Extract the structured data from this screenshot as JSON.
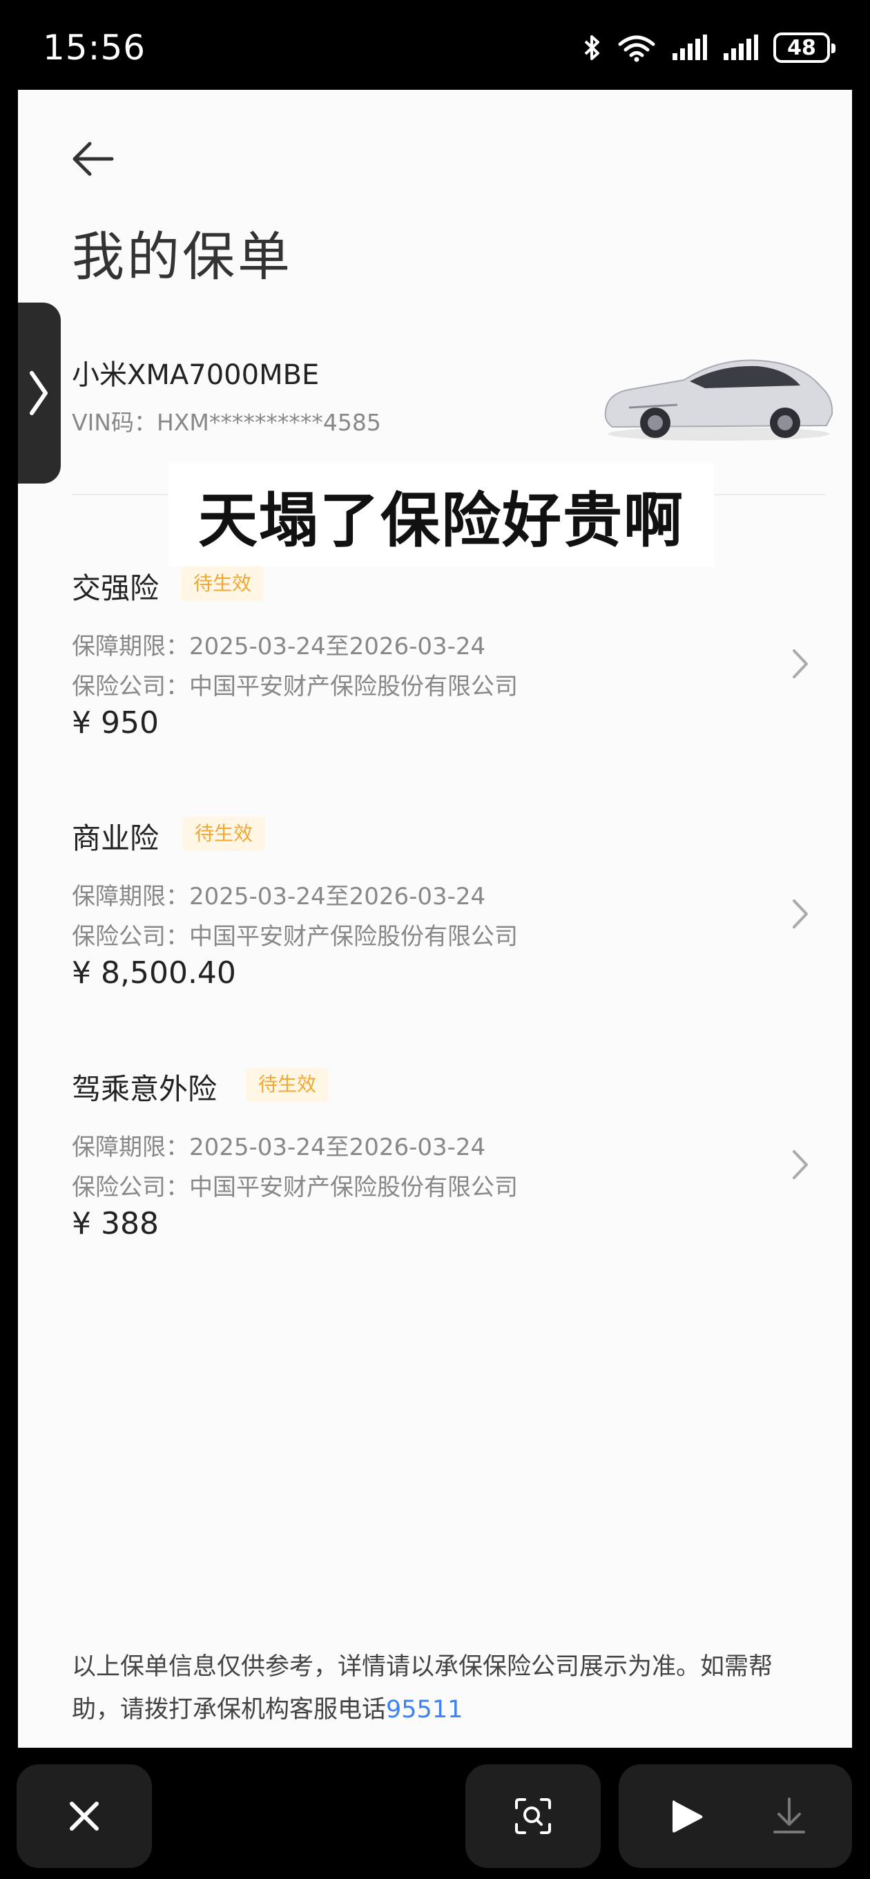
{
  "status_bar": {
    "time": "15:56",
    "battery": "48"
  },
  "header": {
    "title": "我的保单"
  },
  "vehicle": {
    "model": "小米XMA7000MBE",
    "vin": "VIN码：HXM**********4585"
  },
  "overlay_caption": "天塌了保险好贵啊",
  "policies": [
    {
      "name": "交强险",
      "status": "待生效",
      "period": "保障期限：2025-03-24至2026-03-24",
      "company": "保险公司：中国平安财产保险股份有限公司",
      "price": "¥ 950"
    },
    {
      "name": "商业险",
      "status": "待生效",
      "period": "保障期限：2025-03-24至2026-03-24",
      "company": "保险公司：中国平安财产保险股份有限公司",
      "price": "¥ 8,500.40"
    },
    {
      "name": "驾乘意外险",
      "status": "待生效",
      "period": "保障期限：2025-03-24至2026-03-24",
      "company": "保险公司：中国平安财产保险股份有限公司",
      "price": "¥ 388"
    }
  ],
  "footer": {
    "note": "以上保单信息仅供参考，详情请以承保保险公司展示为准。如需帮助，请拨打承保机构客服电话",
    "phone": "95511"
  },
  "icons": {
    "back": "back-arrow-icon",
    "chevron": "chevron-right-icon",
    "close": "close-icon",
    "lens": "scan-search-icon",
    "play": "play-icon",
    "download": "download-icon",
    "bluetooth": "bluetooth-icon",
    "wifi": "wifi-icon",
    "signal": "signal-icon"
  },
  "colors": {
    "badge_text": "#f2a830",
    "badge_bg": "#fff6e6",
    "link": "#3b82f6"
  }
}
